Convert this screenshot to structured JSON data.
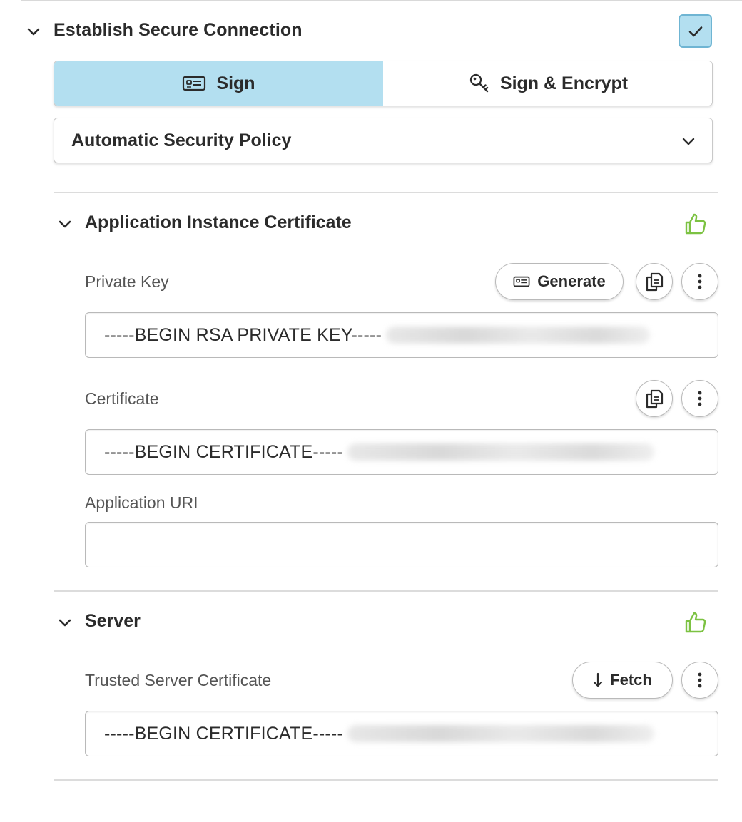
{
  "section": {
    "title": "Establish Secure Connection",
    "enabled": true
  },
  "security_mode": {
    "options": [
      {
        "label": "Sign",
        "icon": "id-card-icon",
        "selected": true
      },
      {
        "label": "Sign & Encrypt",
        "icon": "key-icon",
        "selected": false
      }
    ]
  },
  "policy": {
    "selected": "Automatic Security Policy"
  },
  "app_cert": {
    "title": "Application Instance Certificate",
    "status_icon": "thumbs-up-icon",
    "status_color": "#7cc242",
    "private_key_label": "Private Key",
    "generate_label": "Generate",
    "private_key_value": "-----BEGIN RSA PRIVATE KEY-----",
    "certificate_label": "Certificate",
    "certificate_value": "-----BEGIN CERTIFICATE-----",
    "uri_label": "Application URI",
    "uri_value": ""
  },
  "server": {
    "title": "Server",
    "status_icon": "thumbs-up-icon",
    "status_color": "#7cc242",
    "trusted_label": "Trusted Server Certificate",
    "fetch_label": "Fetch",
    "trusted_value": "-----BEGIN CERTIFICATE-----"
  },
  "colors": {
    "accent": "#b3dff0",
    "accent_border": "#6fb5d3",
    "ok": "#7cc242"
  }
}
